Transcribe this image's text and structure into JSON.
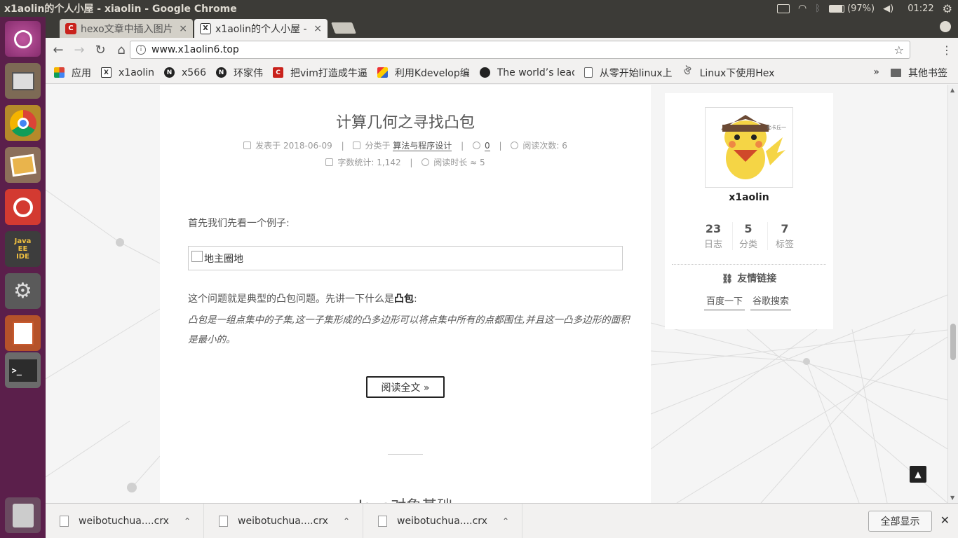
{
  "system_bar": {
    "window_title": "x1aolin的个人小屋 - xiaolin - Google Chrome",
    "battery": "(97%)",
    "time": "01:22"
  },
  "launcher": {
    "items": [
      "ubuntu-dash",
      "files",
      "chrome",
      "shotwell",
      "netease-music",
      "java-ee-ide",
      "system-settings",
      "impress",
      "terminal",
      "trash"
    ],
    "java_ide_label": "Java EE IDE"
  },
  "tabs": [
    {
      "title": "hexo文章中插入图片",
      "active": false
    },
    {
      "title": "x1aolin的个人小屋 -",
      "active": true
    }
  ],
  "toolbar": {
    "url": "www.x1aolin6.top"
  },
  "bookmarks": {
    "items": [
      {
        "label": "应用",
        "icon": "apps-grid-icon"
      },
      {
        "label": "x1aolin",
        "icon": "x-icon"
      },
      {
        "label": "x566",
        "icon": "n-icon"
      },
      {
        "label": "环家伟",
        "icon": "n-icon"
      },
      {
        "label": "把vim打造成牛逼",
        "icon": "csdn-icon"
      },
      {
        "label": "利用Kdevelop编",
        "icon": "image-icon"
      },
      {
        "label": "The world’s lead",
        "icon": "github-icon"
      },
      {
        "label": "从零开始linux上",
        "icon": "page-icon"
      },
      {
        "label": "Linux下使用Hex",
        "icon": "hexo-icon"
      }
    ],
    "more": "»",
    "other": "其他书签"
  },
  "post": {
    "title": "计算几何之寻找凸包",
    "meta": {
      "posted_label": "发表于",
      "posted_date": "2018-06-09",
      "category_label": "分类于",
      "category": "算法与程序设计",
      "comments": "0",
      "views_label": "阅读次数:",
      "views": "6",
      "wordcount_label": "字数统计:",
      "wordcount": "1,142",
      "readtime_label": "阅读时长 ≈",
      "readtime": "5"
    },
    "p1": "首先我们先看一个例子:",
    "image_alt": "地主圈地",
    "p2_before": "这个问题就是典型的凸包问题。先讲一下什么是",
    "p2_bold": "凸包",
    "p2_after": ":",
    "p3": "凸包是一组点集中的子集,这一子集形成的凸多边形可以将点集中所有的点都围住,并且这一凸多边形的面积是最小的。",
    "read_more": "阅读全文 »",
    "next_title": "Java对象基础"
  },
  "sidebar": {
    "author": "x1aolin",
    "avatar_caption": "比卡丘一",
    "stats": [
      {
        "num": "23",
        "label": "日志"
      },
      {
        "num": "5",
        "label": "分类"
      },
      {
        "num": "7",
        "label": "标签"
      }
    ],
    "links_title": "友情链接",
    "links": [
      "百度一下",
      "谷歌搜索"
    ]
  },
  "downloads": {
    "items": [
      "weibotuchua....crx",
      "weibotuchua....crx",
      "weibotuchua....crx"
    ],
    "show_all": "全部显示"
  },
  "colors": {
    "launcher_bg": "#5b1f4b",
    "system_bar_bg": "#3c3b37",
    "chrome_bg": "#f2f1f0"
  }
}
